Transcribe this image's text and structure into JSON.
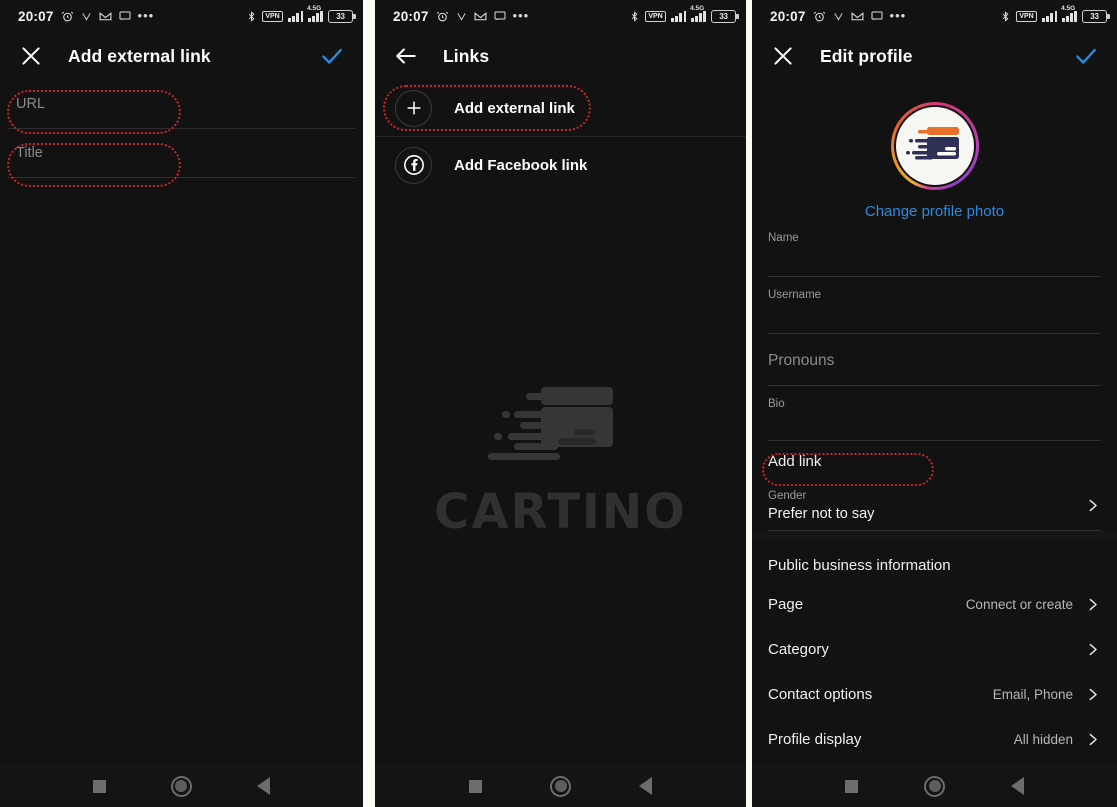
{
  "meta": {
    "divider_color": "#fcfcf5",
    "panel_bg": "#121212",
    "accent_blue": "#2b8ae0",
    "annotation_color": "#c62828"
  },
  "statusbar": {
    "time": "20:07",
    "left_icons": [
      "alarm-icon",
      "v-icon",
      "gmail-icon",
      "message-icon",
      "overflow-dots-icon"
    ],
    "right_icons": [
      "bluetooth-icon",
      "vpn-icon",
      "signal-bars-icon",
      "signal-bars-4g-icon",
      "battery-icon"
    ],
    "vpn_label": "VPN",
    "network_label": "4.5G",
    "battery_level": "33"
  },
  "panel1": {
    "appbar": {
      "close_icon": "close-icon",
      "title": "Add external link",
      "confirm_icon": "check-icon"
    },
    "fields": [
      {
        "name": "url-field",
        "placeholder": "URL",
        "value": "",
        "annotated": true
      },
      {
        "name": "title-field",
        "placeholder": "Title",
        "value": "",
        "annotated": true
      }
    ]
  },
  "panel2": {
    "appbar": {
      "back_icon": "arrow-left-icon",
      "title": "Links"
    },
    "rows": [
      {
        "name": "add-external-link-row",
        "icon": "plus-icon",
        "label": "Add external link",
        "annotated": true
      },
      {
        "name": "add-facebook-link-row",
        "icon": "facebook-icon",
        "label": "Add Facebook link",
        "annotated": false
      }
    ],
    "watermark": {
      "text": "CARTINO",
      "mark": "cartino-logo-icon"
    }
  },
  "panel3": {
    "appbar": {
      "close_icon": "close-icon",
      "title": "Edit profile",
      "confirm_icon": "check-icon"
    },
    "avatar": {
      "name": "profile-avatar",
      "change_photo_label": "Change profile photo"
    },
    "fields": [
      {
        "name": "name-field",
        "label": "Name",
        "value": "",
        "type": "label-value"
      },
      {
        "name": "username-field",
        "label": "Username",
        "value": "",
        "type": "label-value"
      },
      {
        "name": "pronouns-field",
        "placeholder": "Pronouns",
        "type": "placeholder"
      },
      {
        "name": "bio-field",
        "label": "Bio",
        "value": "",
        "type": "label-value"
      }
    ],
    "add_link": {
      "name": "add-link-row",
      "label": "Add link",
      "annotated": true
    },
    "gender": {
      "name": "gender-row",
      "label": "Gender",
      "value": "Prefer not to say",
      "chevron": "chevron-right-icon"
    },
    "business_section": {
      "heading": "Public business information",
      "rows": [
        {
          "name": "page-row",
          "label": "Page",
          "value": "Connect or create",
          "chevron": "chevron-right-icon"
        },
        {
          "name": "category-row",
          "label": "Category",
          "value": "",
          "chevron": "chevron-right-icon"
        },
        {
          "name": "contact-options-row",
          "label": "Contact options",
          "value": "Email, Phone",
          "chevron": "chevron-right-icon"
        },
        {
          "name": "profile-display-row",
          "label": "Profile display",
          "value": "All hidden",
          "chevron": "chevron-right-icon"
        }
      ]
    }
  },
  "navbar": {
    "recents_icon": "square-recents-icon",
    "home_icon": "circle-home-icon",
    "back_icon": "triangle-back-icon"
  }
}
